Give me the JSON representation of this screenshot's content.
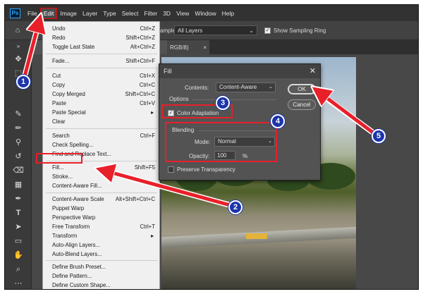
{
  "menubar": {
    "logo": "Ps",
    "items": [
      "File",
      "Edit",
      "Image",
      "Layer",
      "Type",
      "Select",
      "Filter",
      "3D",
      "View",
      "Window",
      "Help"
    ]
  },
  "options_bar": {
    "sample_label": "ample:",
    "sample_value": "All Layers",
    "sampling_ring_label": "Show Sampling Ring",
    "sampling_ring_checked": true
  },
  "document_tab": {
    "label": "RGB/8)"
  },
  "edit_menu": {
    "items": [
      {
        "label": "Undo",
        "shortcut": "Ctrl+Z"
      },
      {
        "label": "Redo",
        "shortcut": "Shift+Ctrl+Z"
      },
      {
        "label": "Toggle Last State",
        "shortcut": "Alt+Ctrl+Z"
      },
      {
        "label": "Fade...",
        "shortcut": "Shift+Ctrl+F"
      },
      {
        "label": "Cut",
        "shortcut": "Ctrl+X"
      },
      {
        "label": "Copy",
        "shortcut": "Ctrl+C"
      },
      {
        "label": "Copy Merged",
        "shortcut": "Shift+Ctrl+C"
      },
      {
        "label": "Paste",
        "shortcut": "Ctrl+V"
      },
      {
        "label": "Paste Special",
        "shortcut": ""
      },
      {
        "label": "Clear",
        "shortcut": ""
      },
      {
        "label": "Search",
        "shortcut": "Ctrl+F"
      },
      {
        "label": "Check Spelling...",
        "shortcut": ""
      },
      {
        "label": "Find and Replace Text...",
        "shortcut": ""
      },
      {
        "label": "Fill...",
        "shortcut": "Shift+F5"
      },
      {
        "label": "Stroke...",
        "shortcut": ""
      },
      {
        "label": "Content-Aware Fill...",
        "shortcut": ""
      },
      {
        "label": "Content-Aware Scale",
        "shortcut": "Alt+Shift+Ctrl+C"
      },
      {
        "label": "Puppet Warp",
        "shortcut": ""
      },
      {
        "label": "Perspective Warp",
        "shortcut": ""
      },
      {
        "label": "Free Transform",
        "shortcut": "Ctrl+T"
      },
      {
        "label": "Transform",
        "shortcut": ""
      },
      {
        "label": "Auto-Align Layers...",
        "shortcut": ""
      },
      {
        "label": "Auto-Blend Layers...",
        "shortcut": ""
      },
      {
        "label": "Define Brush Preset...",
        "shortcut": ""
      },
      {
        "label": "Define Pattern...",
        "shortcut": ""
      },
      {
        "label": "Define Custom Shape...",
        "shortcut": ""
      }
    ]
  },
  "fill_dialog": {
    "title": "Fill",
    "close": "✕",
    "contents_label": "Contents:",
    "contents_value": "Content-Aware",
    "options_label": "Options",
    "color_adaptation_label": "Color Adaptation",
    "color_adaptation_checked": true,
    "blending_label": "Blending",
    "mode_label": "Mode:",
    "mode_value": "Normal",
    "opacity_label": "Opacity:",
    "opacity_value": "100",
    "opacity_unit": "%",
    "preserve_transparency_label": "Preserve Transparency",
    "preserve_transparency_checked": false,
    "ok_label": "OK",
    "cancel_label": "Cancel"
  },
  "callouts": [
    "1",
    "2",
    "3",
    "4",
    "5"
  ],
  "colors": {
    "annotation_red": "#e8202a",
    "badge_blue": "#1c35a8",
    "menu_bg": "#f0f0f0",
    "ui_dark": "#535353"
  }
}
